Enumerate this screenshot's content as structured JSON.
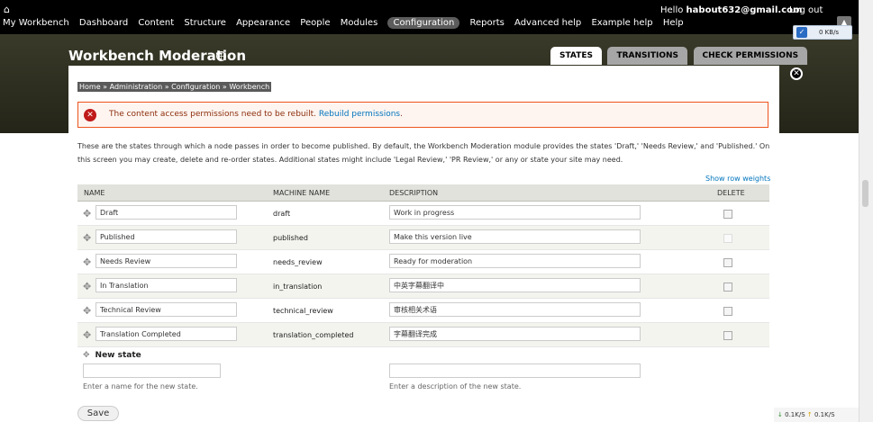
{
  "toolbar": {
    "home_icon": "home-icon",
    "nav_items": [
      "My Workbench",
      "Dashboard",
      "Content",
      "Structure",
      "Appearance",
      "People",
      "Modules",
      "Configuration",
      "Reports",
      "Advanced help",
      "Example help",
      "Help"
    ],
    "active_item": "Configuration",
    "hello_prefix": "Hello",
    "user_email": "habout632@gmail.com",
    "logout": "Log out"
  },
  "header": {
    "title": "Workbench Moderation",
    "tabs": [
      "STATES",
      "TRANSITIONS",
      "CHECK PERMISSIONS"
    ],
    "active_tab": "STATES"
  },
  "breadcrumb": "Home » Administration » Configuration » Workbench",
  "error": {
    "message": "The content access permissions need to be rebuilt.",
    "link": "Rebuild permissions",
    "suffix": "."
  },
  "description": "These are the states through which a node passes in order to become published. By default, the Workbench Moderation module provides the states 'Draft,' 'Needs Review,' and 'Published.' On this screen you may create, delete and re-order states. Additional states might include 'Legal Review,' 'PR Review,' or any or state your site may need.",
  "show_row_weights": "Show row weights",
  "table": {
    "headers": {
      "name": "NAME",
      "machine": "MACHINE NAME",
      "description": "DESCRIPTION",
      "delete": "DELETE"
    },
    "rows": [
      {
        "name": "Draft",
        "machine": "draft",
        "description": "Work in progress",
        "delete_disabled": false
      },
      {
        "name": "Published",
        "machine": "published",
        "description": "Make this version live",
        "delete_disabled": true
      },
      {
        "name": "Needs Review",
        "machine": "needs_review",
        "description": "Ready for moderation",
        "delete_disabled": false
      },
      {
        "name": "In Translation",
        "machine": "in_translation",
        "description": "中英字幕翻译中",
        "delete_disabled": false
      },
      {
        "name": "Technical Review",
        "machine": "technical_review",
        "description": "审核相关术语",
        "delete_disabled": false
      },
      {
        "name": "Translation Completed",
        "machine": "translation_completed",
        "description": "字幕翻译完成",
        "delete_disabled": false
      }
    ],
    "new_state": {
      "label": "New state",
      "name_hint": "Enter a name for the new state.",
      "desc_hint": "Enter a description of the new state."
    }
  },
  "save_label": "Save",
  "speed": {
    "label": "0 KB/s"
  },
  "netstat": {
    "down": "0.1K/S",
    "up": "0.1K/S"
  }
}
